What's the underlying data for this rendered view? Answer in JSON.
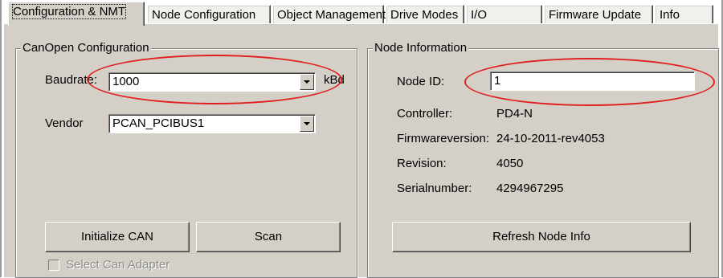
{
  "tabs": [
    {
      "label": "Configuration & NMT",
      "active": true
    },
    {
      "label": "Node Configuration"
    },
    {
      "label": "Object Management"
    },
    {
      "label": "Drive Modes"
    },
    {
      "label": "I/O"
    },
    {
      "label": "Firmware Update"
    },
    {
      "label": "Info"
    }
  ],
  "canopen": {
    "title": "CanOpen Configuration",
    "baudrate_label": "Baudrate:",
    "baudrate_value": "1000",
    "baudrate_unit": "kBd",
    "vendor_label": "Vendor",
    "vendor_value": "PCAN_PCIBUS1",
    "initialize_label": "Initialize CAN",
    "scan_label": "Scan",
    "select_adapter_label": "Select Can Adapter"
  },
  "node": {
    "title": "Node Information",
    "node_id_label": "Node ID:",
    "node_id_value": "1",
    "controller_label": "Controller:",
    "controller_value": "PD4-N",
    "firmware_label": "Firmwareversion:",
    "firmware_value": "24-10-2011-rev4053",
    "revision_label": "Revision:",
    "revision_value": "4050",
    "serial_label": "Serialnumber:",
    "serial_value": "4294967295",
    "refresh_label": "Refresh Node Info"
  },
  "colors": {
    "highlight_ellipse": "#e02020",
    "panel_bg": "#d4d0c8"
  }
}
